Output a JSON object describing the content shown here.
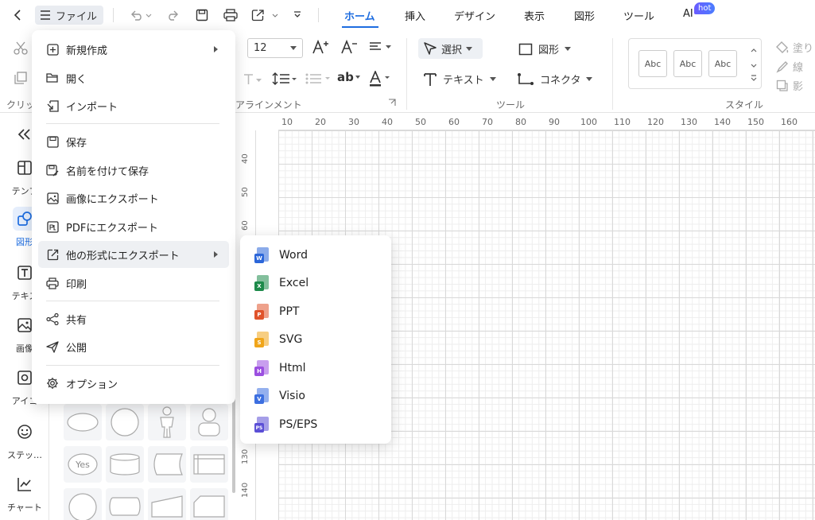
{
  "topbar": {
    "file_label": "ファイル",
    "tabs": [
      {
        "label": "ホーム",
        "active": true
      },
      {
        "label": "挿入",
        "active": false
      },
      {
        "label": "デザイン",
        "active": false
      },
      {
        "label": "表示",
        "active": false
      },
      {
        "label": "図形",
        "active": false
      },
      {
        "label": "ツール",
        "active": false
      },
      {
        "label": "AI",
        "active": false
      }
    ],
    "ai_badge": "hot"
  },
  "ribbon": {
    "font_size": "12",
    "select_label": "選択",
    "shape_label": "図形",
    "text_label": "テキスト",
    "connector_label": "コネクタ",
    "group_clipboard": "クリッ",
    "group_alignment": "アラインメント",
    "group_tool": "ツール",
    "group_style": "スタイル",
    "style_samples": [
      "Abc",
      "Abc",
      "Abc"
    ],
    "fill_label": "塗り",
    "line_label": "線",
    "shadow_label": "影"
  },
  "sidebar": {
    "items": [
      {
        "label": "テンプ",
        "icon": "template-icon",
        "active": false
      },
      {
        "label": "図形",
        "icon": "shapes-icon",
        "active": true
      },
      {
        "label": "テキス",
        "icon": "text-icon",
        "active": false
      },
      {
        "label": "画像",
        "icon": "image-icon",
        "active": false
      },
      {
        "label": "アイコ",
        "icon": "icon-library-icon",
        "active": false
      },
      {
        "label": "ステッ…",
        "icon": "sticker-icon",
        "active": false
      },
      {
        "label": "チャート",
        "icon": "chart-icon",
        "active": false
      }
    ]
  },
  "shapes_panel": {
    "yes_label": "Yes"
  },
  "ruler": {
    "top": [
      "10",
      "20",
      "30",
      "40",
      "50",
      "60",
      "70",
      "80",
      "90",
      "100",
      "110",
      "120",
      "130",
      "140",
      "150",
      "160"
    ],
    "left_visible": [
      "40",
      "50",
      "60",
      "130",
      "140"
    ]
  },
  "file_menu": {
    "items": [
      {
        "label": "新規作成",
        "icon": "new-file-icon",
        "submenu": true
      },
      {
        "label": "開く",
        "icon": "folder-open-icon",
        "submenu": false
      },
      {
        "label": "インポート",
        "icon": "import-icon",
        "submenu": false
      },
      {
        "label": "保存",
        "icon": "save-icon",
        "submenu": false
      },
      {
        "label": "名前を付けて保存",
        "icon": "save-as-icon",
        "submenu": false
      },
      {
        "label": "画像にエクスポート",
        "icon": "export-image-icon",
        "submenu": false
      },
      {
        "label": "PDFにエクスポート",
        "icon": "export-pdf-icon",
        "submenu": false
      },
      {
        "label": "他の形式にエクスポート",
        "icon": "export-other-icon",
        "submenu": true
      },
      {
        "label": "印刷",
        "icon": "print-icon",
        "submenu": false
      },
      {
        "label": "共有",
        "icon": "share-icon",
        "submenu": false
      },
      {
        "label": "公開",
        "icon": "publish-icon",
        "submenu": false
      },
      {
        "label": "オプション",
        "icon": "gear-icon",
        "submenu": false
      }
    ]
  },
  "export_submenu": {
    "items": [
      {
        "label": "Word",
        "badge": "W",
        "color": "#2b66d9"
      },
      {
        "label": "Excel",
        "badge": "X",
        "color": "#1d8a4a"
      },
      {
        "label": "PPT",
        "badge": "P",
        "color": "#e0532b"
      },
      {
        "label": "SVG",
        "badge": "S",
        "color": "#f0a51a"
      },
      {
        "label": "Html",
        "badge": "H",
        "color": "#9b4fe0"
      },
      {
        "label": "Visio",
        "badge": "V",
        "color": "#3c6fe0"
      },
      {
        "label": "PS/EPS",
        "badge": "PS",
        "color": "#5b4fd6"
      }
    ]
  },
  "colors": {
    "accent": "#1e6de0",
    "hover": "#eef0f3"
  }
}
